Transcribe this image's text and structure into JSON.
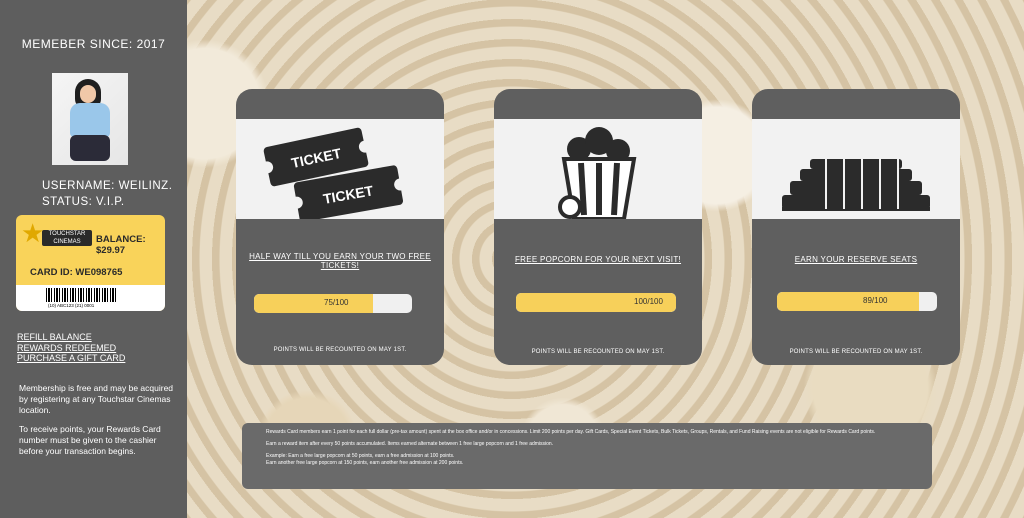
{
  "sidebar": {
    "member_since": "MEMEBER SINCE: 2017",
    "username": "USERNAME: WEILINZ.",
    "status": "STATUS: V.I.P.",
    "card": {
      "logo_text": "TOUCHSTAR CINEMAS",
      "balance": "BALANCE: $29.97",
      "card_id": "CARD ID: WE098765",
      "barcode_number": "(10) ABC123 (21) 0001"
    },
    "links": [
      "REFILL BALANCE",
      "REWARDS REDEEMED",
      "PURCHASE A GIFT CARD"
    ],
    "info_1": "Membership is free and may be acquired by registering at any Touchstar Cinemas location.",
    "info_2": "To receive points, your Rewards Card number must be given to the cashier before your transaction begins."
  },
  "rewards": [
    {
      "title": "HALF WAY TILL YOU EARN YOUR TWO FREE TICKETS!",
      "progress_text": "75/100",
      "progress": 0.75,
      "note": "POINTS WILL BE RECOUNTED ON MAY 1ST.",
      "icon": "ticket-icon"
    },
    {
      "title": "FREE POPCORN FOR YOUR NEXT VISIT!",
      "progress_text": "100/100",
      "progress": 1.0,
      "note": "POINTS WILL BE RECOUNTED ON MAY 1ST.",
      "icon": "popcorn-icon"
    },
    {
      "title": "EARN YOUR RESERVE SEATS",
      "progress_text": "89/100",
      "progress": 0.89,
      "note": "POINTS WILL BE RECOUNTED ON MAY 1ST.",
      "icon": "seats-icon"
    }
  ],
  "bottom_text": {
    "p1": "Rewards Card members earn 1 point for each full dollar (pre-tax amount) spent at the box office and/or in concessions. Limit 200 points per day. Gift Cards, Special Event Tickets, Bulk Tickets, Groups, Rentals, and Fund Raising events are not eligible for Rewards Card points.",
    "p2": "Earn a reward item after every 50 points accumulated. Items earned alternate between 1 free large popcorn and 1 free admission.",
    "p3": "Example: Earn a free large popcorn at 50 points, earn a free admission at 100 points.",
    "p4": "Earn another free large popcorn at 150 points, earn another free admission at 200 points."
  },
  "colors": {
    "sidebar_bg": "#5e5e5e",
    "card_yellow": "#f9d35a",
    "progress_yellow": "#f7d05a",
    "panel_bg": "#5f5f5f"
  }
}
